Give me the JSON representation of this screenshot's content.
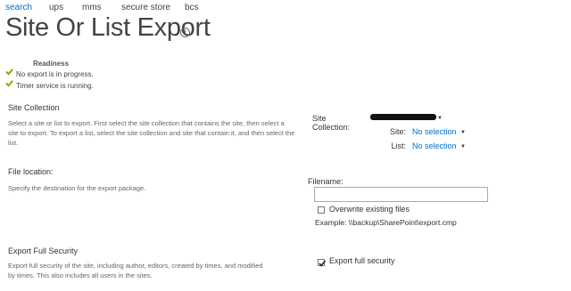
{
  "nav": {
    "items": [
      "search",
      "ups",
      "mms",
      "secure store",
      "bcs"
    ]
  },
  "page": {
    "title": "Site Or List Export",
    "info_glyph": "i"
  },
  "readiness": {
    "heading": "Readiness",
    "items": [
      "No export is in progress.",
      "Timer service is running."
    ]
  },
  "site_collection": {
    "heading": "Site Collection",
    "description": "Select a site or list to export.  First select the site collection that contains the site, then select a site to export. To export a list, select the site collection and site that contain it, and then select the list.",
    "collection_label": "Site Collection:",
    "site_label": "Site:",
    "site_value": "No selection",
    "list_label": "List:",
    "list_value": "No selection",
    "dropdown_glyph": "▼"
  },
  "file_location": {
    "heading": "File location:",
    "description": "Specify the destination for the export package.",
    "filename_label": "Filename:",
    "filename_value": "",
    "overwrite_label": "Overwrite existing files",
    "overwrite_checked": false,
    "example": "Example: \\\\backup\\SharePoint\\export.cmp"
  },
  "security": {
    "heading": "Export Full Security",
    "description": "Export full security of the site, including author, editors, created by times, and modified by times. This also includes all users in the sites.",
    "checkbox_label": "Export full security",
    "checked": true
  },
  "colors": {
    "accent": "#0072c6",
    "check_green": "#5a9e2f",
    "check_yellow": "#e8b400"
  }
}
